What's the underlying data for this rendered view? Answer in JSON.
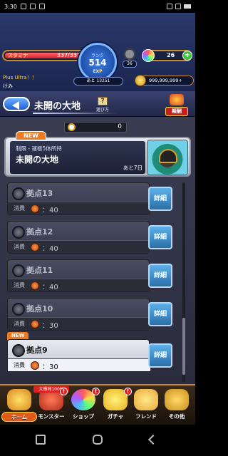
{
  "status_bar": {
    "time": "3:30"
  },
  "header": {
    "hp": {
      "label": "スタミナ",
      "text": "337/337",
      "fill_fraction": 1.0
    },
    "rank": {
      "label": "ランク",
      "value": "514"
    },
    "exp": {
      "label": "EXP",
      "remaining_text": "あと 13251"
    },
    "medal": {
      "count": "36"
    },
    "orbs": {
      "count": "26",
      "plus": "+"
    },
    "player": {
      "title": "Plus Ultra！！",
      "name": "けみ"
    },
    "gold": {
      "count": "999,999,999+"
    }
  },
  "titlebar": {
    "title": "未開の大地",
    "help_label": "遊び方",
    "help_glyph": "?",
    "reward_label": "報酬"
  },
  "timer": {
    "value": "0"
  },
  "event": {
    "new_tag": "NEW",
    "condition": "制限 - 運極5体所持",
    "name": "未開の大地",
    "remaining": "あと7日"
  },
  "stages": [
    {
      "name": "拠点13",
      "cost_label": "消費",
      "cost": "：40",
      "detail": "詳細"
    },
    {
      "name": "拠点12",
      "cost_label": "消費",
      "cost": "：40",
      "detail": "詳細"
    },
    {
      "name": "拠点11",
      "cost_label": "消費",
      "cost": "：40",
      "detail": "詳細"
    },
    {
      "name": "拠点10",
      "cost_label": "消費",
      "cost": "：30",
      "detail": "詳細"
    },
    {
      "name": "拠点9",
      "cost_label": "消費",
      "cost": "：30",
      "detail": "詳細",
      "new_tag": "NEW"
    }
  ],
  "nav": {
    "items": [
      {
        "label": "ホーム"
      },
      {
        "label": "モンスター",
        "tag": "大爆発100%",
        "alert": "!"
      },
      {
        "label": "ショップ",
        "alert": "!"
      },
      {
        "label": "ガチャ",
        "alert": "!"
      },
      {
        "label": "フレンド"
      },
      {
        "label": "その他"
      }
    ]
  }
}
